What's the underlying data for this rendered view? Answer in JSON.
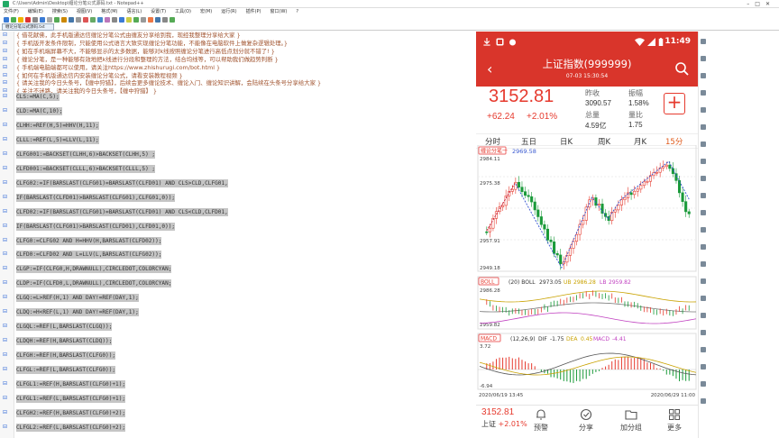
{
  "editor": {
    "title": "C:\\Users\\Admin\\Desktop\\缠论分笔公式源码.txt - Notepad++",
    "menu": [
      "文件(F)",
      "编辑(E)",
      "搜索(S)",
      "视图(V)",
      "格式(M)",
      "语言(L)",
      "设置(T)",
      "工具(O)",
      "宏(M)",
      "运行(R)",
      "插件(P)",
      "窗口(W)",
      "?"
    ],
    "tab": "缠论分笔公式源码.txt",
    "lines": [
      {
        "text": "{ 借花献佛，此手机版通达信缠论分笔公式由缠友分享给到我，现经我整理分享给大家 }",
        "kind": "cn"
      },
      {
        "text": "{ 手机版开发条件限制，只能使用公式语言大致实现缠论分笔功能，不能像在电脑软件上做复杂逻辑处理。}",
        "kind": "cn"
      },
      {
        "text": "{ 如在手机端屏幕不大，不能够显示的太多数据，能够对k线按照缠论分笔进行高低点划分就不错了! }",
        "kind": "cn"
      },
      {
        "text": "{ 缠论分笔，是一种能够有效地把k线进行分段和整理的方法，结合均线等，可以帮助我们做趋势判断 }",
        "kind": "cn"
      },
      {
        "text": "{ 手机端电脑端都可以使用，请关注https://www.zhishurugi.com/bot.html }",
        "kind": "cn"
      },
      {
        "text": "{ 如何在手机版通达信内安装缠论分笔公式，请看安装教程视频 }",
        "kind": "cn"
      },
      {
        "text": "{ 请关注我的今日头条号，【缠中狩猎】，后续会更多缠论技术、缠论入门、缠论知识讲解，会陆续在头条号分享给大家 }",
        "kind": "cn"
      },
      {
        "text": "{ 关注不迷路，请关注我的今日头条号，【缠中狩猎】 }",
        "kind": "cn"
      },
      {
        "text": "CLS:=MA(C,5);",
        "kind": "sel"
      },
      {
        "text": "CLD:=MA(C,10);",
        "kind": "sel"
      },
      {
        "text": "CLHH:=REF(H,5)=HHV(H,11);",
        "kind": "sel"
      },
      {
        "text": "CLLL:=REF(L,5)=LLV(L,11);",
        "kind": "sel"
      },
      {
        "text": "CLFG001:=BACKSET(CLHH,6)>BACKSET(CLHH,5) ;",
        "kind": "sel"
      },
      {
        "text": "CLFD001:=BACKSET(CLLL,6)>BACKSET(CLLL,5) ;",
        "kind": "sel"
      },
      {
        "text": "CLFG02:=IF(BARSLAST(CLFG01)=BARSLAST(CLFD01) AND CLS>CLD,CLFG01,",
        "kind": "sel"
      },
      {
        "text": "IF(BARSLAST(CLFD01)>BARSLAST(CLFG01),CLFG01,0));",
        "kind": "sel"
      },
      {
        "text": "CLFD02:=IF(BARSLAST(CLFG01)=BARSLAST(CLFD01) AND CLS<CLD,CLFD01,",
        "kind": "sel"
      },
      {
        "text": "IF(BARSLAST(CLFG01)>BARSLAST(CLFD01),CLFD01,0));",
        "kind": "sel"
      },
      {
        "text": "CLFG0:=CLFG02 AND H=HHV(H,BARSLAST(CLFD02));",
        "kind": "sel"
      },
      {
        "text": "CLFD0:=CLFD02 AND L=LLV(L,BARSLAST(CLFG02));",
        "kind": "sel"
      },
      {
        "text": "CLGP:=IF(CLFG0,H,DRAWNULL),CIRCLEDOT,COLORCYAN;",
        "kind": "sel"
      },
      {
        "text": "CLDP:=IF(CLFD0,L,DRAWNULL),CIRCLEDOT,COLORCYAN;",
        "kind": "sel"
      },
      {
        "text": "CLGQ:=L>REF(H,1) AND DAY!=REF(DAY,1);",
        "kind": "sel"
      },
      {
        "text": "CLDQ:=H<REF(L,1) AND DAY!=REF(DAY,1);",
        "kind": "sel"
      },
      {
        "text": "CLGQL:=REF(L,BARSLAST(CLGQ));",
        "kind": "sel"
      },
      {
        "text": "CLDQH:=REF(H,BARSLAST(CLDQ));",
        "kind": "sel"
      },
      {
        "text": "CLFGH:=REF(H,BARSLAST(CLFG0));",
        "kind": "sel"
      },
      {
        "text": "CLFGL:=REF(L,BARSLAST(CLFG0));",
        "kind": "sel"
      },
      {
        "text": "CLFGL1:=REF(H,BARSLAST(CLFG0)+1);",
        "kind": "sel"
      },
      {
        "text": "CLFGL1:=REF(L,BARSLAST(CLFG0)+1);",
        "kind": "sel"
      },
      {
        "text": "CLFGH2:=REF(H,BARSLAST(CLFG0)+2);",
        "kind": "sel"
      },
      {
        "text": "CLFGL2:=REF(L,BARSLAST(CLFG0)+2);",
        "kind": "sel"
      }
    ]
  },
  "phone": {
    "status": {
      "time": "11:49"
    },
    "header": {
      "name": "上证指数(999999)",
      "datetime": "07-03 15:30:54"
    },
    "quote": {
      "price": "3152.81",
      "change": "+62.24",
      "change_pct": "+2.01%",
      "prev_close_label": "昨收",
      "prev_close": "3090.57",
      "amplitude_label": "振幅",
      "amplitude": "1.58%",
      "volume_label": "总量",
      "volume": "4.59亿",
      "ratio_label": "量比",
      "ratio": "1.75",
      "add_label": "+"
    },
    "periods": [
      "分时",
      "五日",
      "日K",
      "周K",
      "月K",
      "15分"
    ],
    "main_chart": {
      "indicator": "缠论分笔一",
      "readout": "2969.58",
      "ticks": [
        "2984.11",
        "2975.38",
        "2957.91",
        "2949.18"
      ]
    },
    "boll_panel": {
      "indicator": "BOLL",
      "params": "(20) BOLL",
      "boll_val": "2973.05",
      "ub_label": "UB",
      "ub_val": "2986.28",
      "lb_label": "LB",
      "lb_val": "2959.82",
      "ticks": [
        "2986.28",
        "2959.82"
      ]
    },
    "macd_panel": {
      "indicator": "MACD",
      "params": "(12,26,9)",
      "dif_label": "DIF",
      "dif_val": "-1.75",
      "dea_label": "DEA",
      "dea_val": "0.45",
      "macd_label": "MACD",
      "macd_val": "-4.41",
      "ticks": [
        "3.72",
        "-6.94"
      ]
    },
    "dates": {
      "start": "2020/06/19 13:45",
      "end": "2020/06/29 11:00"
    },
    "bottom": {
      "mini_price": "3152.81",
      "mini_name": "上证",
      "mini_pct": "+2.01%",
      "nav": [
        "预警",
        "分享",
        "加分组",
        "更多"
      ]
    }
  },
  "colors": {
    "brand_red": "#d9352b",
    "up_red": "#e63a2e",
    "down_green": "#1a9a3a",
    "boll_ub": "#c9a200",
    "boll_lb": "#c040c0",
    "macd_dif": "#555555",
    "macd_dea": "#c9a200",
    "active_tab": "#e05a1a"
  }
}
